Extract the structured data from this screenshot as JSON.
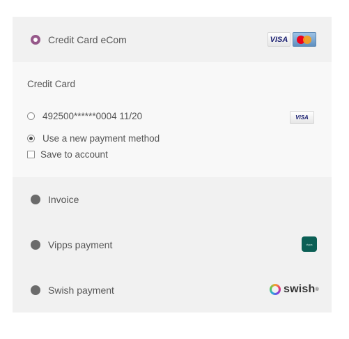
{
  "payment_methods": {
    "credit_card_ecom": {
      "label": "Credit Card eCom",
      "logos": {
        "visa": "VISA",
        "mastercard": "MasterCard"
      }
    },
    "credit_card_section": {
      "title": "Credit Card",
      "saved_card": {
        "label": "492500******0004 11/20",
        "logo": "VISA"
      },
      "new_method_label": "Use a new payment method",
      "save_to_account_label": "Save to account"
    },
    "invoice": {
      "label": "Invoice"
    },
    "vipps": {
      "label": "Vipps payment",
      "logo": "vipps"
    },
    "swish": {
      "label": "Swish payment",
      "logo": "swish",
      "logo_mark": "®"
    }
  },
  "colors": {
    "selected_radio": "#96588a",
    "panel": "#f1f1f1",
    "subpanel": "#f8f8f8",
    "vipps": "#0b5f55"
  }
}
